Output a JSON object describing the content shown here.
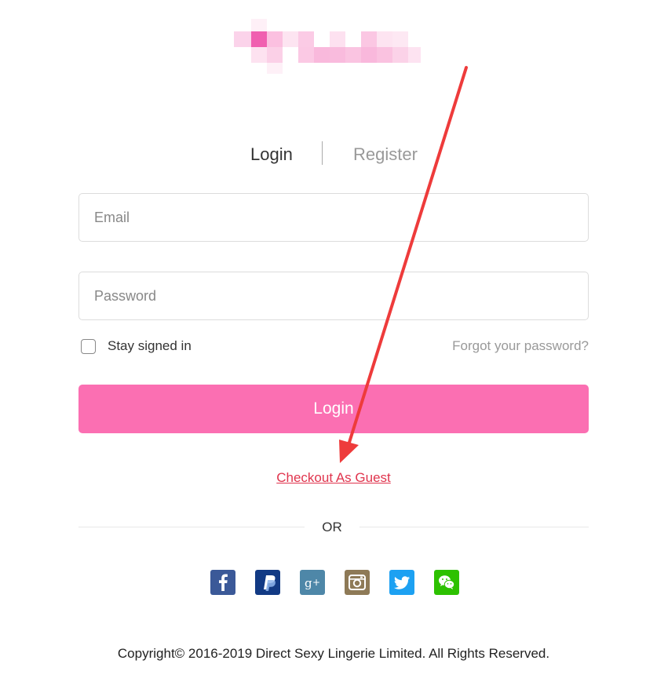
{
  "tabs": {
    "login": "Login",
    "register": "Register"
  },
  "form": {
    "email_placeholder": "Email",
    "password_placeholder": "Password",
    "stay_signed_in": "Stay signed in",
    "forgot_password": "Forgot your password?",
    "login_button": "Login"
  },
  "guest_link": "Checkout As Guest",
  "or_label": "OR",
  "socials": [
    {
      "name": "facebook",
      "glyph": "f",
      "color": "#3b5998"
    },
    {
      "name": "paypal",
      "glyph": "P",
      "color": "#123a84"
    },
    {
      "name": "google-plus",
      "glyph": "g+",
      "color": "#4e87a8"
    },
    {
      "name": "instagram",
      "glyph": "",
      "color": "#8e7a57"
    },
    {
      "name": "twitter",
      "glyph": "",
      "color": "#1da1f2"
    },
    {
      "name": "wechat",
      "glyph": "",
      "color": "#2dc100"
    }
  ],
  "footer": "Copyright© 2016-2019 Direct Sexy Lingerie Limited. All Rights Reserved.",
  "colors": {
    "accent": "#fb6fb2",
    "guest_link": "#e0344d",
    "annotation_arrow": "#ee3b3b"
  }
}
